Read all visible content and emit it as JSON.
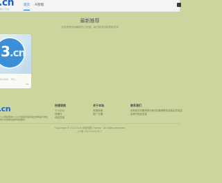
{
  "header": {
    "logo": ".cn",
    "logo_sub": "网 址 导 航",
    "nav": [
      {
        "label": "首页"
      },
      {
        "label": "AI智能"
      }
    ]
  },
  "main": {
    "title": "最新推荐",
    "subtitle": "为您推荐全网最新热门资源，每日精选持续更新收录",
    "cards": [
      {
        "logo_main": "3",
        "logo_tld": ".cn",
        "caption": "提交收录… 网址…",
        "views": "96"
      }
    ]
  },
  "footer": {
    "logo": ".cn",
    "description": "3.cn网站导航(3.cn)为您提供最新最全的网站分类目录与优质网址推荐导航服务",
    "columns": [
      {
        "title": "快速导航",
        "links": [
          "个人中心",
          "投稿文",
          "网站导航"
        ]
      },
      {
        "title": "关于本站",
        "links": [
          "常规使用",
          "推广位置"
        ]
      },
      {
        "title": "联系我们",
        "text": "如有相关问题请您与我们的客服联系或者由您发送给我们相应信息"
      }
    ],
    "copyright": "Copyright © 2023 3.cn 网址导航 Theme · All rights reserved",
    "icp": "ICP备 2023XXXXX号-1"
  }
}
